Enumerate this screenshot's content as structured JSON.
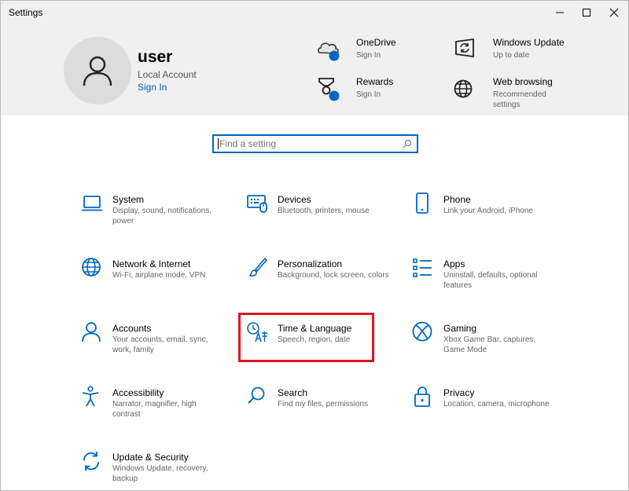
{
  "window": {
    "title": "Settings"
  },
  "account": {
    "name": "user",
    "type": "Local Account",
    "signin_label": "Sign In"
  },
  "header_tiles": [
    {
      "title": "OneDrive",
      "subtitle": "Sign In",
      "icon": "onedrive-icon"
    },
    {
      "title": "Windows Update",
      "subtitle": "Up to date",
      "icon": "windows-update-icon"
    },
    {
      "title": "Rewards",
      "subtitle": "Sign In",
      "icon": "rewards-icon"
    },
    {
      "title": "Web browsing",
      "subtitle": "Recommended settings",
      "icon": "globe-icon"
    }
  ],
  "search": {
    "placeholder": "Find a setting"
  },
  "categories": [
    {
      "title": "System",
      "desc": "Display, sound, notifications, power",
      "icon": "laptop-icon"
    },
    {
      "title": "Devices",
      "desc": "Bluetooth, printers, mouse",
      "icon": "keyboard-icon"
    },
    {
      "title": "Phone",
      "desc": "Link your Android, iPhone",
      "icon": "phone-icon"
    },
    {
      "title": "Network & Internet",
      "desc": "Wi-Fi, airplane mode, VPN",
      "icon": "globe-icon"
    },
    {
      "title": "Personalization",
      "desc": "Background, lock screen, colors",
      "icon": "brush-icon"
    },
    {
      "title": "Apps",
      "desc": "Uninstall, defaults, optional features",
      "icon": "apps-list-icon"
    },
    {
      "title": "Accounts",
      "desc": "Your accounts, email, sync, work, family",
      "icon": "person-icon"
    },
    {
      "title": "Time & Language",
      "desc": "Speech, region, date",
      "icon": "time-language-icon"
    },
    {
      "title": "Gaming",
      "desc": "Xbox Game Bar, captures, Game Mode",
      "icon": "xbox-icon"
    },
    {
      "title": "Accessibility",
      "desc": "Narrator, magnifier, high contrast",
      "icon": "accessibility-icon"
    },
    {
      "title": "Search",
      "desc": "Find my files, permissions",
      "icon": "search-icon"
    },
    {
      "title": "Privacy",
      "desc": "Location, camera, microphone",
      "icon": "lock-icon"
    },
    {
      "title": "Update & Security",
      "desc": "Windows Update, recovery, backup",
      "icon": "sync-icon"
    }
  ],
  "colors": {
    "accent": "#0067c0",
    "highlight": "#e0141e",
    "header_bg": "#f0f0f0"
  }
}
